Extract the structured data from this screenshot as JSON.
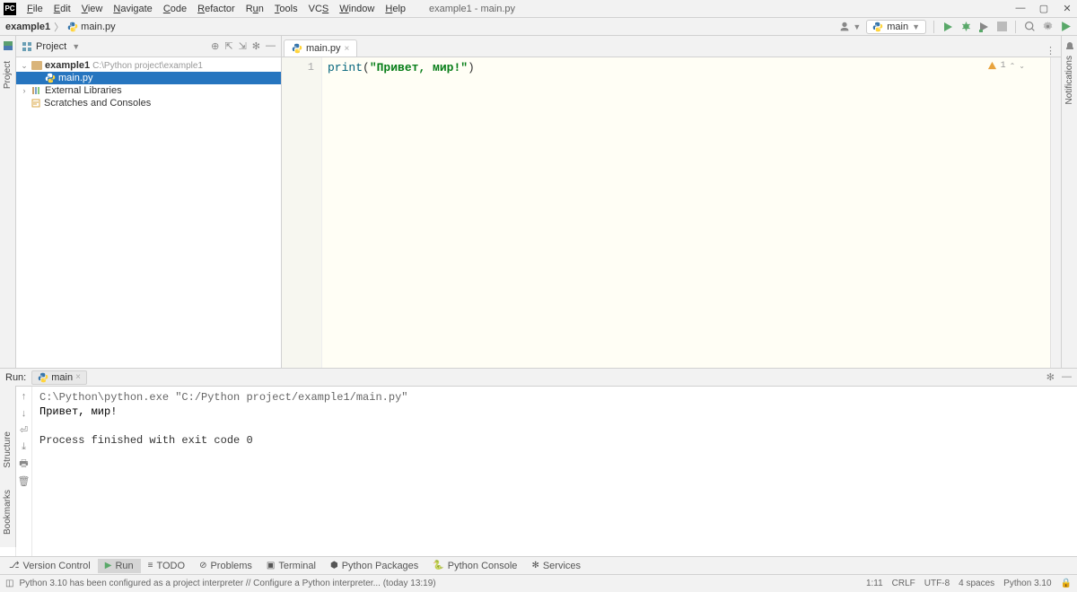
{
  "window": {
    "title": "example1 - main.py",
    "app_badge": "PC"
  },
  "menu": [
    "File",
    "Edit",
    "View",
    "Navigate",
    "Code",
    "Refactor",
    "Run",
    "Tools",
    "VCS",
    "Window",
    "Help"
  ],
  "breadcrumb": {
    "project": "example1",
    "file": "main.py"
  },
  "run_config": {
    "name": "main"
  },
  "project_panel": {
    "title": "Project",
    "root": "example1",
    "root_path": "C:\\Python project\\example1",
    "file": "main.py",
    "external": "External Libraries",
    "scratches": "Scratches and Consoles"
  },
  "editor": {
    "tab": "main.py",
    "line_no": "1",
    "code_fn": "print",
    "code_open": "(",
    "code_str": "\"Привет, мир!\"",
    "code_close": ")",
    "analysis": "1"
  },
  "run": {
    "label": "Run:",
    "tab": "main",
    "cmd": "C:\\Python\\python.exe \"C:/Python project/example1/main.py\"",
    "output": "Привет, мир!",
    "exit": "Process finished with exit code 0"
  },
  "bottom_tabs": {
    "vcs": "Version Control",
    "run": "Run",
    "todo": "TODO",
    "problems": "Problems",
    "terminal": "Terminal",
    "pkg": "Python Packages",
    "console": "Python Console",
    "services": "Services"
  },
  "status": {
    "msg": "Python 3.10 has been configured as a project interpreter // Configure a Python interpreter... (today 13:19)",
    "pos": "1:11",
    "eol": "CRLF",
    "enc": "UTF-8",
    "indent": "4 spaces",
    "interp": "Python 3.10"
  },
  "side_labels": {
    "project": "Project",
    "notifications": "Notifications",
    "structure": "Structure",
    "bookmarks": "Bookmarks"
  }
}
